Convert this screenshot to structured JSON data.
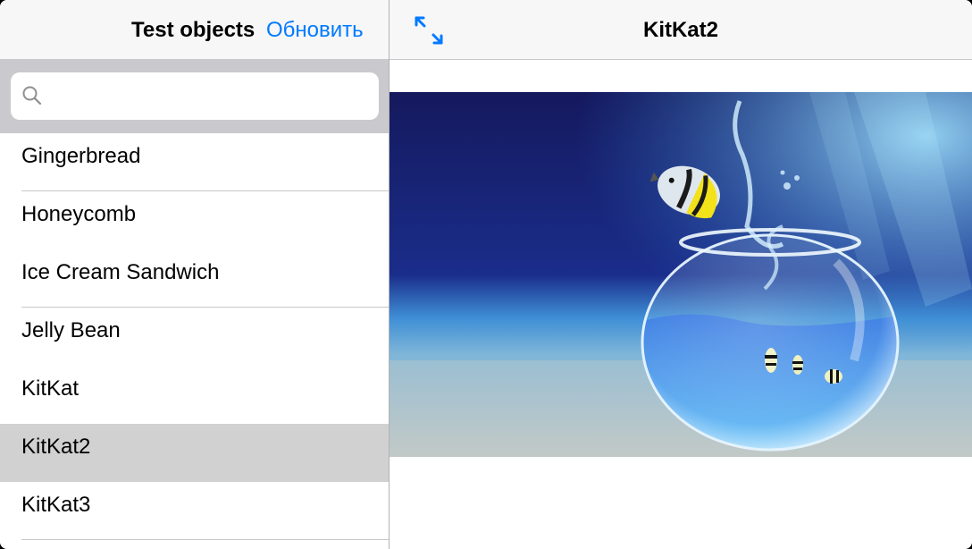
{
  "master": {
    "title": "Test objects",
    "refresh_label": "Обновить",
    "search": {
      "placeholder": "",
      "value": ""
    },
    "items": [
      {
        "label": "Gingerbread",
        "selected": false
      },
      {
        "label": "Honeycomb",
        "selected": false
      },
      {
        "label": "Ice Cream Sandwich",
        "selected": false
      },
      {
        "label": "Jelly Bean",
        "selected": false
      },
      {
        "label": "KitKat",
        "selected": false
      },
      {
        "label": "KitKat2",
        "selected": true
      },
      {
        "label": "KitKat3",
        "selected": false
      }
    ]
  },
  "detail": {
    "title": "KitKat2",
    "expand_icon": "expand-arrows-icon",
    "image_subject": "fish-jumping-from-fishbowl"
  },
  "colors": {
    "accent": "#007aff",
    "nav_background": "#f7f7f7",
    "search_background": "#c9c9ce",
    "selected_row": "#d1d1d1"
  }
}
